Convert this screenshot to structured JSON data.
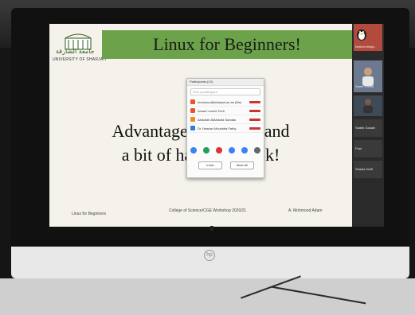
{
  "slide": {
    "title": "Linux for Beginners!",
    "arabic_name": "جامعة الشارقة",
    "english_name": "UNIVERSITY OF SHARJAH",
    "body_line1": "Advantages of Linux and",
    "body_line2": "a bit of hands on look!",
    "footer_left": "Linux for Beginners",
    "footer_mid": "College of Science/CGE Workshop 2020/21",
    "footer_right": "A. Mohmood Adam"
  },
  "participants_panel": {
    "title": "Participants (10)",
    "search_placeholder": "Find a participant",
    "rows": [
      {
        "name": "mohmood@sharjah.ac.ae (Me)",
        "color": "#e4572e"
      },
      {
        "name": "Ansari Lucent Tech",
        "color": "#e4572e"
      },
      {
        "name": "Abdullah AlAbdulla Sandas",
        "color": "#f08a24"
      },
      {
        "name": "Dr. Hassan Moustafa Fathy",
        "color": "#2e7dd7"
      }
    ],
    "invite_label": "Invite",
    "mute_all_label": "Mute All"
  },
  "side_panel": {
    "tile_top": "khaled khfaja...",
    "tile_mid_name": "Samir Hamid",
    "tile_label_3": "Sadek Gosain",
    "tile_label_4": "Fran",
    "tile_label_5": "Shadia Hofif"
  },
  "brand": {
    "hp_logo": "hp"
  },
  "colors": {
    "banner": "#6ca24a",
    "slide_bg": "#f4f2ea",
    "chin": "#e8e8e8"
  }
}
